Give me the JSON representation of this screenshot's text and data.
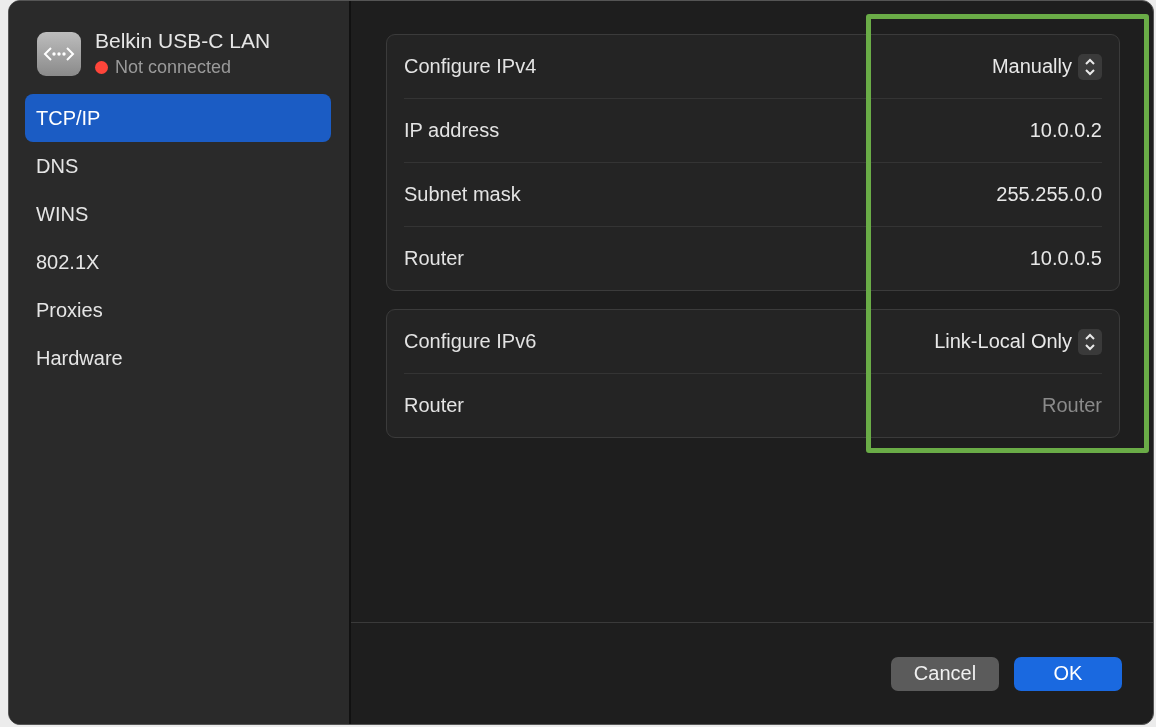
{
  "device": {
    "name": "Belkin USB-C LAN",
    "status": "Not connected",
    "color": "#ff453a"
  },
  "sidebar": {
    "items": [
      {
        "label": "TCP/IP",
        "selected": true
      },
      {
        "label": "DNS",
        "selected": false
      },
      {
        "label": "WINS",
        "selected": false
      },
      {
        "label": "802.1X",
        "selected": false
      },
      {
        "label": "Proxies",
        "selected": false
      },
      {
        "label": "Hardware",
        "selected": false
      }
    ]
  },
  "groups": [
    {
      "rows": [
        {
          "kind": "popup",
          "label": "Configure IPv4",
          "value": "Manually"
        },
        {
          "kind": "field",
          "label": "IP address",
          "value": "10.0.0.2"
        },
        {
          "kind": "field",
          "label": "Subnet mask",
          "value": "255.255.0.0"
        },
        {
          "kind": "field",
          "label": "Router",
          "value": "10.0.0.5"
        }
      ]
    },
    {
      "rows": [
        {
          "kind": "popup",
          "label": "Configure IPv6",
          "value": "Link-Local Only"
        },
        {
          "kind": "field",
          "label": "Router",
          "placeholder": "Router"
        }
      ]
    }
  ],
  "buttons": [
    {
      "label": "Cancel",
      "kind": "secondary"
    },
    {
      "label": "OK",
      "kind": "primary"
    }
  ]
}
